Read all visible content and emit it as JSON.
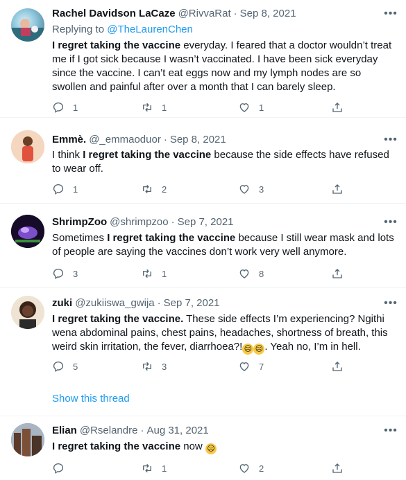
{
  "tweets": [
    {
      "name": "Rachel Davidson LaCaze",
      "handle": "@RivvaRat",
      "date": "Sep 8, 2021",
      "replying_prefix": "Replying to ",
      "replying_to": "@TheLaurenChen",
      "text_bold": "I regret taking the vaccine",
      "text_rest": " everyday. I feared that a doctor wouldn’t treat me if I got sick because I wasn’t vaccinated. I have been sick everyday since the vaccine. I can’t eat eggs now and my lymph nodes are so swollen and painful after over a month that I can barely sleep.",
      "replies": "1",
      "retweets": "1",
      "likes": "1"
    },
    {
      "name": "Emmè.",
      "handle": "@_emmaoduor",
      "date": "Sep 8, 2021",
      "text_prefix": "I think ",
      "text_bold": "I regret taking the vaccine",
      "text_rest": " because the side effects have refused to wear off.",
      "replies": "1",
      "retweets": "2",
      "likes": "3"
    },
    {
      "name": "ShrimpZoo",
      "handle": "@shrimpzoo",
      "date": "Sep 7, 2021",
      "text_prefix": "Sometimes ",
      "text_bold": "I regret taking the vaccine",
      "text_rest": " because I still wear mask and lots of  people are saying the vaccines don’t work very well anymore.",
      "replies": "3",
      "retweets": "1",
      "likes": "8"
    },
    {
      "name": "zuki",
      "handle": "@zukiiswa_gwija",
      "date": "Sep 7, 2021",
      "text_bold": "I regret taking the vaccine.",
      "text_rest": " These side effects I’m experiencing? Ngithi wena abdominal pains, chest pains, headaches, shortness of breath, this weird skin irritation, the fever, diarrhoea?!",
      "text_after_emoji": ". Yeah no, I’m in hell.",
      "replies": "5",
      "retweets": "3",
      "likes": "7",
      "show_thread": "Show this thread"
    },
    {
      "name": "Elian",
      "handle": "@Rselandre",
      "date": "Aug 31, 2021",
      "text_bold": "I regret taking the vaccine",
      "text_rest": " now",
      "replies": "",
      "retweets": "1",
      "likes": "2"
    }
  ],
  "separator": "·",
  "more_icon": "more-horizontal-icon",
  "colors": {
    "accent": "#1d9bf0",
    "secondary": "#536471",
    "text": "#0f1419",
    "divider": "#eff3f4"
  }
}
